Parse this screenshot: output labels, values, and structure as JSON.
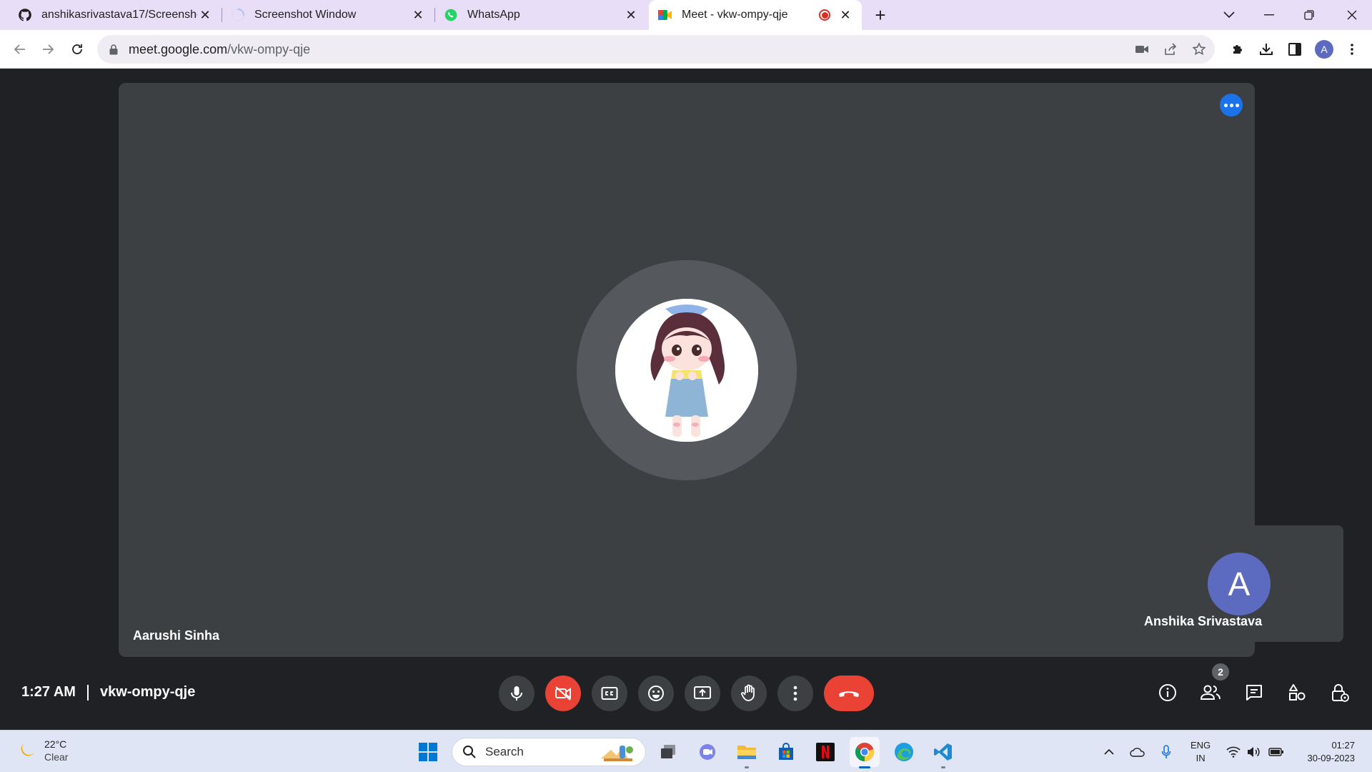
{
  "browser": {
    "tabs": [
      {
        "title": "anshikasrivastava17/Screenshot_",
        "icon": "github-icon",
        "active": false
      },
      {
        "title": "Screenshot Window",
        "icon": "loading-spinner-icon",
        "active": false
      },
      {
        "title": "WhatsApp",
        "icon": "whatsapp-icon",
        "active": false
      },
      {
        "title": "Meet - vkw-ompy-qje",
        "icon": "google-meet-icon",
        "active": true,
        "recording": true
      }
    ],
    "address": {
      "host": "meet.google.com",
      "path": "/vkw-ompy-qje"
    },
    "profile_initial": "A"
  },
  "meet": {
    "main_participant": {
      "name": "Aarushi Sinha"
    },
    "self_participant": {
      "name": "Anshika Srivastava",
      "initial": "A"
    },
    "time": "1:27 AM",
    "meeting_code": "vkw-ompy-qje",
    "participant_count": "2",
    "colors": {
      "accent": "#1a73e8",
      "danger": "#ea4335",
      "tile": "#3c4043",
      "background": "#202124",
      "avatar": "#5c6bc0"
    }
  },
  "taskbar": {
    "weather": {
      "temp": "22°C",
      "condition": "Clear"
    },
    "search_label": "Search",
    "language": {
      "line1": "ENG",
      "line2": "IN"
    },
    "clock": {
      "time": "01:27",
      "date": "30-09-2023"
    }
  }
}
